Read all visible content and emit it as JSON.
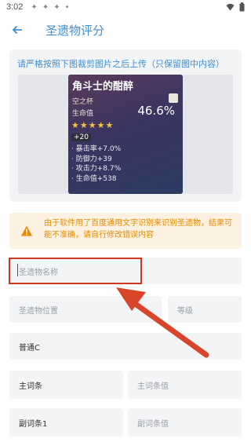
{
  "status": {
    "time": "3:02"
  },
  "appbar": {
    "title": "圣遗物评分"
  },
  "card": {
    "instruction": "请严格按照下图裁剪图片之后上传（只保留图中内容）",
    "artifact": {
      "name": "角斗士的酣醉",
      "type": "空之杯",
      "main_label": "生命值",
      "main_value": "46.6%",
      "stars": "★★★★★",
      "level": "+20",
      "substats": [
        "· 暴击率+7.0%",
        "· 防御力+39",
        "· 攻击力+8.7%",
        "· 生命值+538"
      ]
    }
  },
  "warning": {
    "text": "由于软件用了百度通用文字识别来识别圣遗物，结果可能不准确，请自行修改错误内容"
  },
  "form": {
    "name_placeholder": "圣遗物名称",
    "position_placeholder": "圣遗物位置",
    "level_placeholder": "等级",
    "quality_value": "普通C",
    "main_label": "主词条",
    "main_value_placeholder": "主词条值",
    "sub1_label": "副词条1",
    "sub1_value_placeholder": "副词条值"
  },
  "colors": {
    "accent": "#3f8fd6",
    "warning": "#e68a00",
    "highlight": "#c8391f"
  }
}
